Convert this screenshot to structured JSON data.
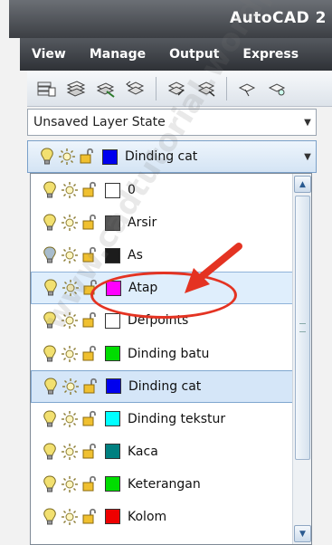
{
  "title_bar": {
    "app_title": "AutoCAD 2"
  },
  "menu": {
    "items": [
      "View",
      "Manage",
      "Output",
      "Express"
    ]
  },
  "toolbar": {
    "buttons": [
      "layer-properties-icon",
      "layer-states-icon",
      "make-current-icon",
      "match-layer-icon",
      "layer-previous-icon",
      "layer-isolate-icon",
      "layer-walk-icon",
      "layer-freeze-icon"
    ]
  },
  "layer_state": {
    "value": "Unsaved Layer State"
  },
  "current_layer": {
    "name": "Dinding cat",
    "color": "#0000ee"
  },
  "layers": [
    {
      "name": "0",
      "color": "#ffffff",
      "bulb": "#f2e070"
    },
    {
      "name": "Arsir",
      "color": "#555555",
      "bulb": "#f2e070"
    },
    {
      "name": "As",
      "color": "#1c1c1c",
      "bulb": "#a8bccc"
    },
    {
      "name": "Atap",
      "color": "#ff00ff",
      "bulb": "#f2e070",
      "state": "hover"
    },
    {
      "name": "Defpoints",
      "color": "#ffffff",
      "bulb": "#f2e070"
    },
    {
      "name": "Dinding batu",
      "color": "#00dd00",
      "bulb": "#f2e070"
    },
    {
      "name": "Dinding cat",
      "color": "#0000ee",
      "bulb": "#f2e070",
      "state": "selected"
    },
    {
      "name": "Dinding tekstur",
      "color": "#00ffff",
      "bulb": "#f2e070"
    },
    {
      "name": "Kaca",
      "color": "#008080",
      "bulb": "#f2e070"
    },
    {
      "name": "Keterangan",
      "color": "#00dd00",
      "bulb": "#f2e070"
    },
    {
      "name": "Kolom",
      "color": "#ee0000",
      "bulb": "#f2e070"
    }
  ],
  "watermark": "www.cadtutorial.wordpress.com",
  "colors": {
    "annotation": "#e43322",
    "selection": "#d5e6f8"
  }
}
